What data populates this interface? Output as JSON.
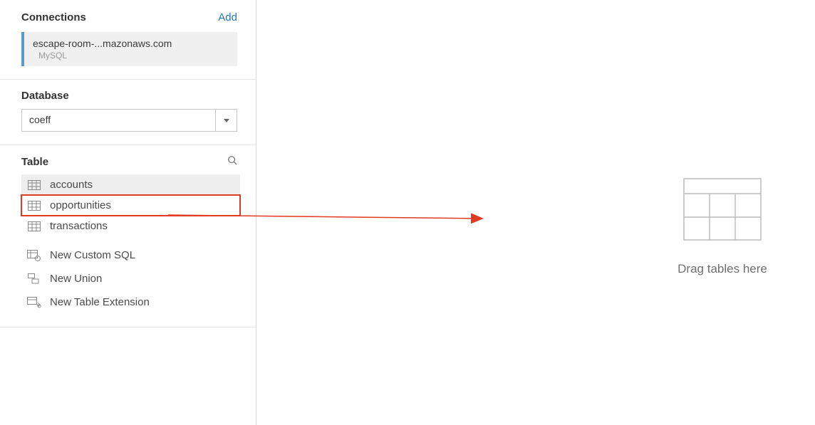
{
  "connections": {
    "title": "Connections",
    "add_label": "Add",
    "items": [
      {
        "host": "escape-room-...mazonaws.com",
        "type": "MySQL"
      }
    ]
  },
  "database": {
    "label": "Database",
    "selected": "coeff"
  },
  "tables": {
    "label": "Table",
    "items": [
      {
        "name": "accounts"
      },
      {
        "name": "opportunities"
      },
      {
        "name": "transactions"
      }
    ]
  },
  "actions": {
    "custom_sql": "New Custom SQL",
    "new_union": "New Union",
    "table_extension": "New Table Extension"
  },
  "canvas": {
    "drop_hint": "Drag tables here"
  }
}
